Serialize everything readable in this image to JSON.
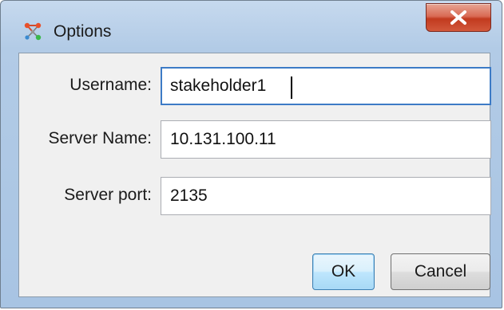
{
  "window": {
    "title": "Options",
    "app_icon": "app-graph-icon",
    "close_icon": "close-icon"
  },
  "form": {
    "username": {
      "label": "Username:",
      "value": "stakeholder1",
      "focused": true
    },
    "server_name": {
      "label": "Server Name:",
      "value": "10.131.100.11"
    },
    "server_port": {
      "label": "Server port:",
      "value": "2135"
    }
  },
  "buttons": {
    "ok_label": "OK",
    "cancel_label": "Cancel"
  },
  "colors": {
    "titlebar": "#bcd2ea",
    "close_button": "#c23a1f",
    "focus_border": "#3d7bc6",
    "default_button": "#bee6fd",
    "panel": "#f0f0f0"
  }
}
